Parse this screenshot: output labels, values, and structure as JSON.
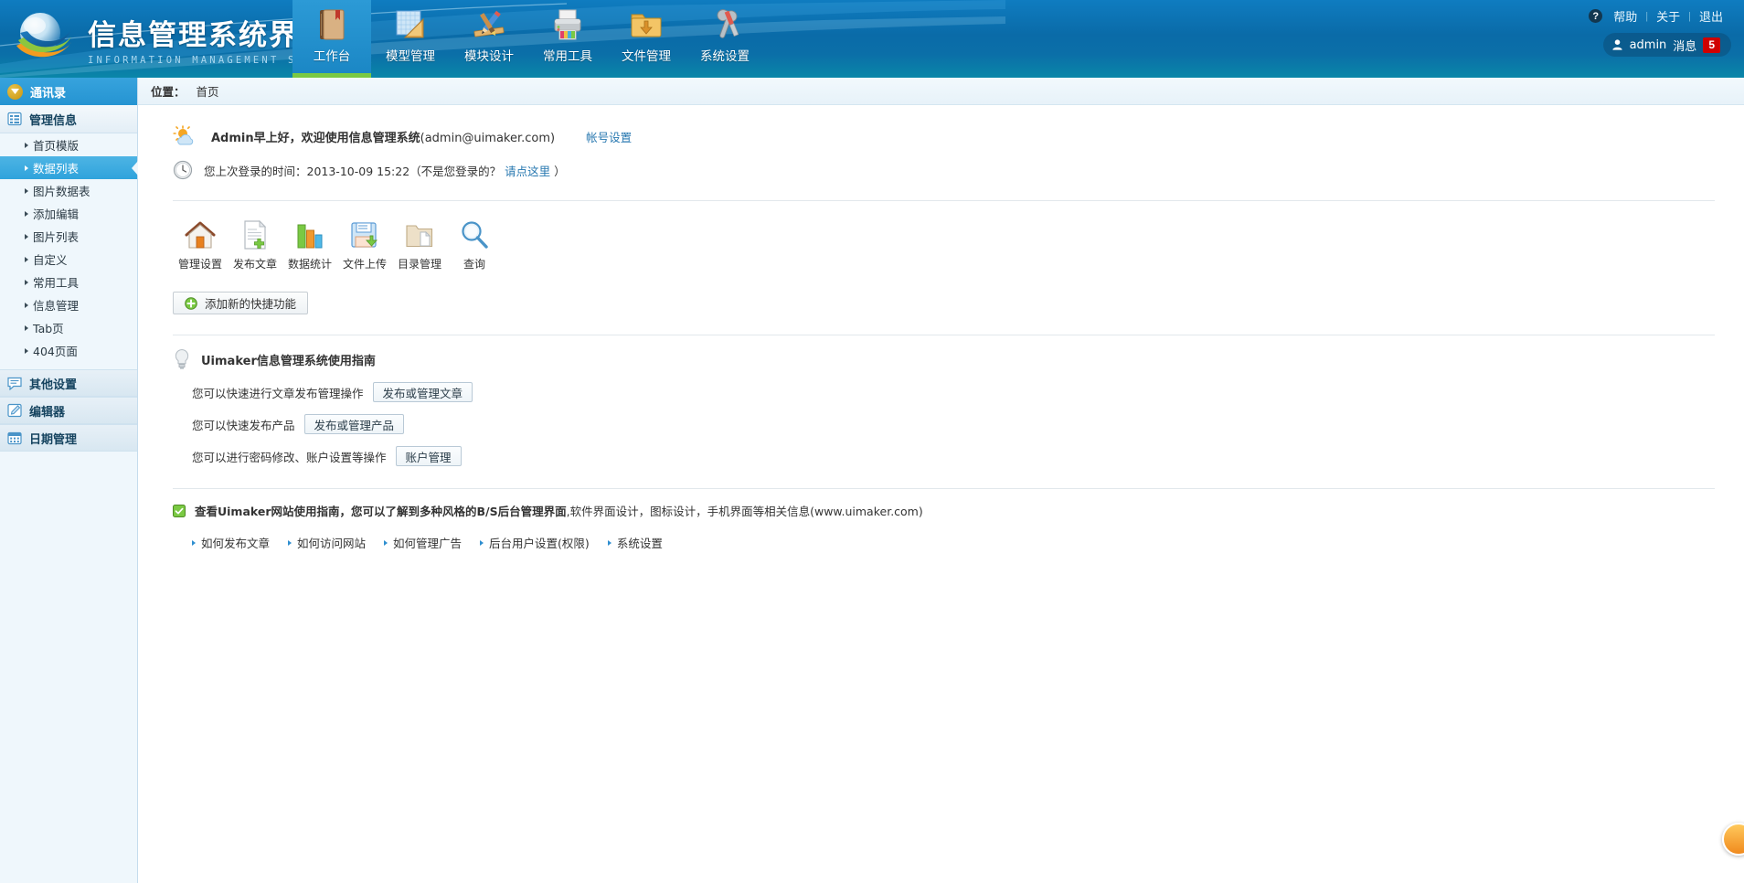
{
  "header": {
    "logo_title": "信息管理系统界面",
    "logo_subtitle": "INFORMATION MANAGEMENT SYSTEM GUI",
    "nav": [
      {
        "label": "工作台",
        "icon": "book-icon",
        "active": true
      },
      {
        "label": "模型管理",
        "icon": "ruler-icon",
        "active": false
      },
      {
        "label": "模块设计",
        "icon": "pencil-brush-icon",
        "active": false
      },
      {
        "label": "常用工具",
        "icon": "printer-icon",
        "active": false
      },
      {
        "label": "文件管理",
        "icon": "folder-download-icon",
        "active": false
      },
      {
        "label": "系统设置",
        "icon": "wrench-screwdriver-icon",
        "active": false
      }
    ],
    "top_links": [
      {
        "label": "帮助",
        "icon": "question-icon"
      },
      {
        "label": "关于",
        "icon": ""
      },
      {
        "label": "退出",
        "icon": ""
      }
    ],
    "separator": "|",
    "user": {
      "name": "admin",
      "messages_label": "消息",
      "messages_count": "5",
      "avatar_icon": "user-icon"
    }
  },
  "sidebar": {
    "top": {
      "label": "通讯录",
      "icon": "chevron-down-circle-icon"
    },
    "group": {
      "label": "管理信息",
      "icon": "list-icon"
    },
    "items": [
      {
        "label": "首页模版",
        "active": false
      },
      {
        "label": "数据列表",
        "active": true
      },
      {
        "label": "图片数据表",
        "active": false
      },
      {
        "label": "添加编辑",
        "active": false
      },
      {
        "label": "图片列表",
        "active": false
      },
      {
        "label": "自定义",
        "active": false
      },
      {
        "label": "常用工具",
        "active": false
      },
      {
        "label": "信息管理",
        "active": false
      },
      {
        "label": "Tab页",
        "active": false
      },
      {
        "label": "404页面",
        "active": false
      }
    ],
    "blocks": [
      {
        "label": "其他设置",
        "icon": "comment-icon"
      },
      {
        "label": "编辑器",
        "icon": "edit-icon"
      },
      {
        "label": "日期管理",
        "icon": "calendar-icon"
      }
    ]
  },
  "breadcrumb": {
    "label": "位置：",
    "current": "首页"
  },
  "welcome": {
    "icon": "weather-sun-cloud-icon",
    "greeting_bold": "Admin早上好，欢迎使用信息管理系统",
    "email": "(admin@uimaker.com)",
    "account_link": "帐号设置"
  },
  "last_login": {
    "icon": "clock-icon",
    "prefix": "您上次登录的时间：2013-10-09 15:22（不是您登录的？",
    "link": "请点这里",
    "suffix": "）"
  },
  "shortcuts": [
    {
      "label": "管理设置",
      "icon": "home-icon"
    },
    {
      "label": "发布文章",
      "icon": "document-add-icon"
    },
    {
      "label": "数据统计",
      "icon": "bar-chart-icon"
    },
    {
      "label": "文件上传",
      "icon": "floppy-upload-icon"
    },
    {
      "label": "目录管理",
      "icon": "folder-file-icon"
    },
    {
      "label": "查询",
      "icon": "magnifier-icon"
    }
  ],
  "add_shortcut": {
    "label": "添加新的快捷功能",
    "icon": "plus-circle-icon"
  },
  "guide": {
    "icon": "lightbulb-icon",
    "title": "Uimaker信息管理系统使用指南",
    "rows": [
      {
        "text": "您可以快速进行文章发布管理操作",
        "button": "发布或管理文章"
      },
      {
        "text": "您可以快速发布产品",
        "button": "发布或管理产品"
      },
      {
        "text": "您可以进行密码修改、账户设置等操作",
        "button": "账户管理"
      }
    ]
  },
  "notice": {
    "icon": "green-square-icon",
    "bold_prefix": "查看Uimaker网站使用指南，您可以了解到多种风格的B/S后台管理界面",
    "rest": ",软件界面设计，图标设计，手机界面等相关信息",
    "url": "(www.uimaker.com)"
  },
  "foot_links": [
    {
      "label": "如何发布文章"
    },
    {
      "label": "如何访问网站"
    },
    {
      "label": "如何管理广告"
    },
    {
      "label": "后台用户设置(权限)"
    },
    {
      "label": "系统设置"
    }
  ],
  "colors": {
    "header_blue": "#0a6ba8",
    "accent_green": "#7ac943",
    "active_blue": "#2fa3dc",
    "badge_red": "#d00000",
    "link_blue": "#2878b0"
  }
}
